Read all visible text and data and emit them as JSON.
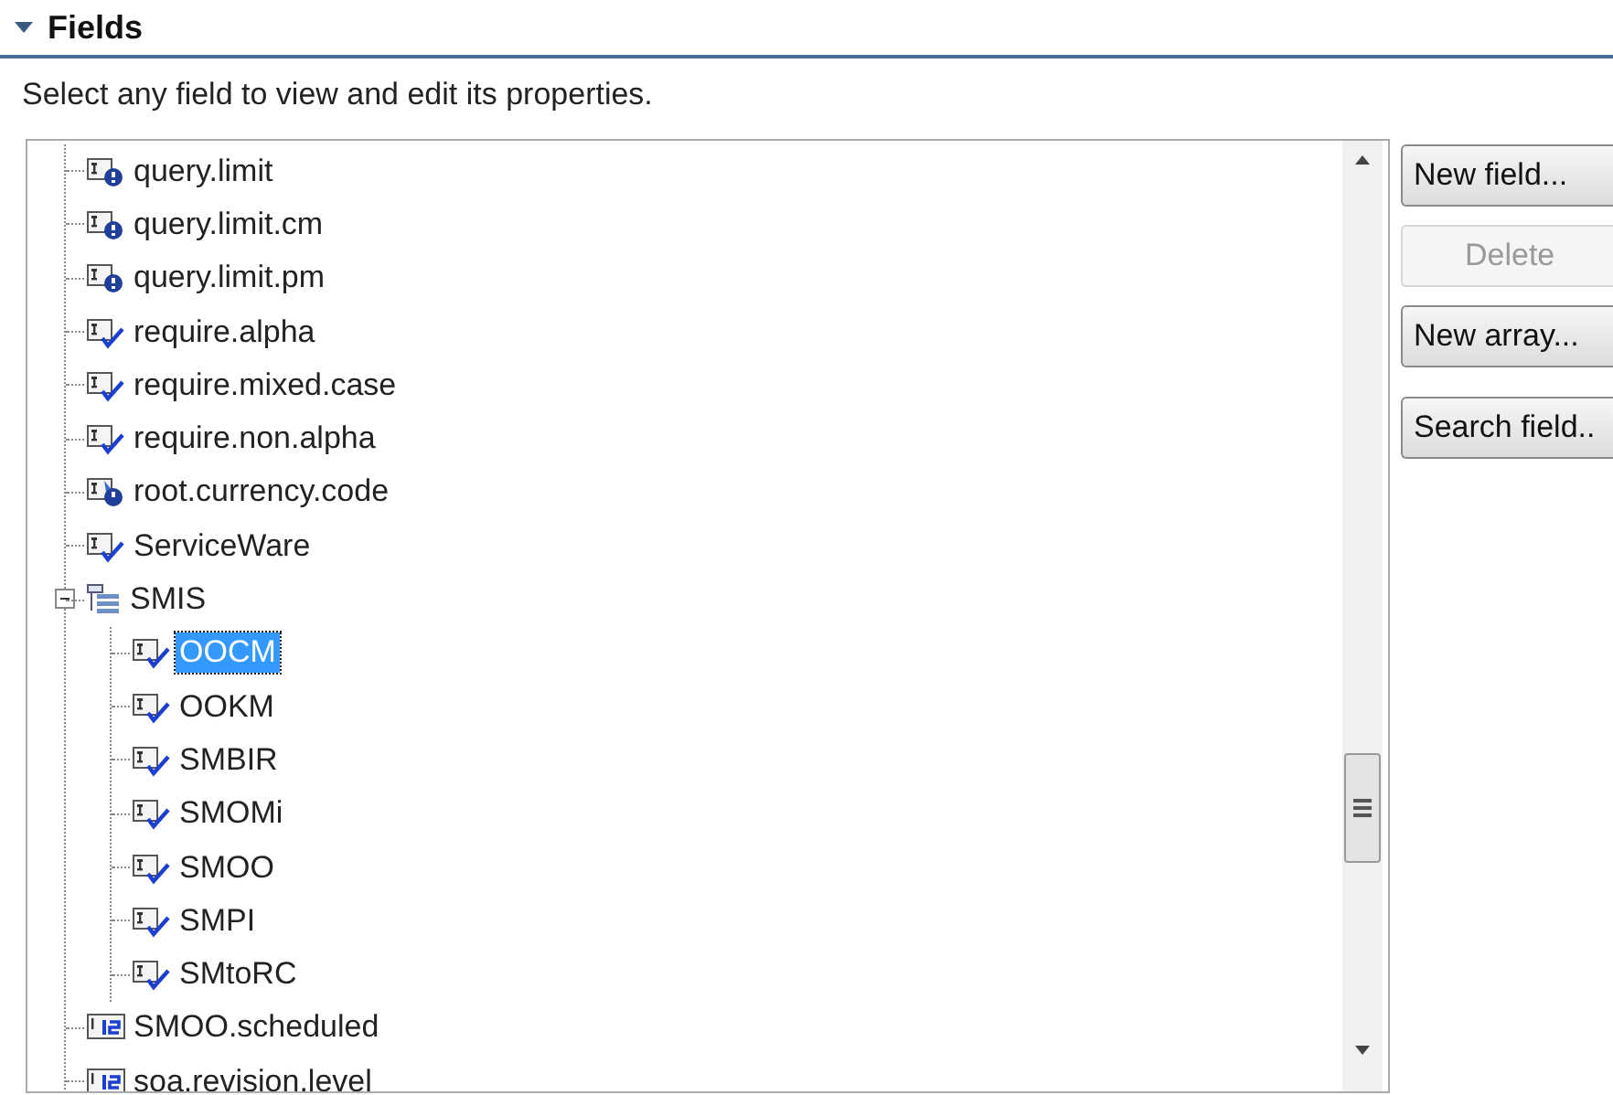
{
  "section": {
    "title": "Fields",
    "expanded": true,
    "description": "Select any field to view and edit its properties."
  },
  "tree": [
    {
      "label": "query.limit",
      "kind": "query",
      "selected": false
    },
    {
      "label": "query.limit.cm",
      "kind": "query",
      "selected": false
    },
    {
      "label": "query.limit.pm",
      "kind": "query",
      "selected": false
    },
    {
      "label": "require.alpha",
      "kind": "check",
      "selected": false
    },
    {
      "label": "require.mixed.case",
      "kind": "check",
      "selected": false
    },
    {
      "label": "require.non.alpha",
      "kind": "check",
      "selected": false
    },
    {
      "label": "root.currency.code",
      "kind": "currency",
      "selected": false
    },
    {
      "label": "ServiceWare",
      "kind": "check",
      "selected": false
    },
    {
      "label": "SMIS",
      "kind": "group",
      "selected": false,
      "expanded": true,
      "children": [
        {
          "label": "OOCM",
          "kind": "check",
          "selected": true
        },
        {
          "label": "OOKM",
          "kind": "check",
          "selected": false
        },
        {
          "label": "SMBIR",
          "kind": "check",
          "selected": false
        },
        {
          "label": "SMOMi",
          "kind": "check",
          "selected": false
        },
        {
          "label": "SMOO",
          "kind": "check",
          "selected": false
        },
        {
          "label": "SMPI",
          "kind": "check",
          "selected": false
        },
        {
          "label": "SMtoRC",
          "kind": "check",
          "selected": false
        }
      ]
    },
    {
      "label": "SMOO.scheduled",
      "kind": "number",
      "selected": false
    },
    {
      "label": "soa.revision.level",
      "kind": "number",
      "selected": false
    }
  ],
  "buttons": [
    {
      "label": "New field...",
      "disabled": false
    },
    {
      "label": "Delete",
      "disabled": true
    },
    {
      "label": "New array...",
      "disabled": false
    },
    {
      "label": "Search field..",
      "disabled": false
    }
  ]
}
